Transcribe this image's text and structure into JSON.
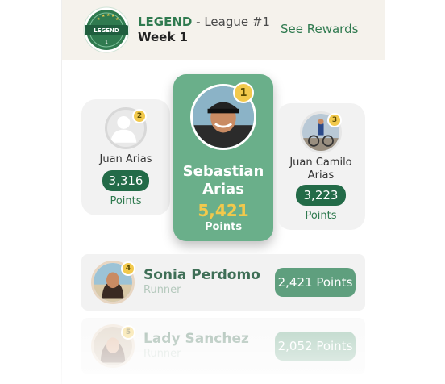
{
  "header": {
    "league_name": "LEGEND",
    "league_suffix": " - League #1",
    "week": "Week 1",
    "rewards_link": "See Rewards",
    "badge_text": "LEGEND",
    "badge_sub": "1"
  },
  "podium": {
    "first": {
      "rank": "1",
      "name": "Sebastian Arias",
      "points": "5,421",
      "points_label": "Points"
    },
    "second": {
      "rank": "2",
      "name": "Juan Arias",
      "points": "3,316",
      "points_label": "Points"
    },
    "third": {
      "rank": "3",
      "name": "Juan Camilo Arias",
      "points": "3,223",
      "points_label": "Points"
    }
  },
  "list": [
    {
      "rank": "4",
      "name": "Sonia Perdomo",
      "role": "Runner",
      "points": "2,421 Points"
    },
    {
      "rank": "5",
      "name": "Lady Sanchez",
      "role": "Runner",
      "points": "2,052 Points"
    }
  ],
  "colors": {
    "brand": "#2f7a4f",
    "accent_gold": "#f2c94c",
    "podium_first": "#6aaf8a",
    "pill": "#236b48"
  }
}
